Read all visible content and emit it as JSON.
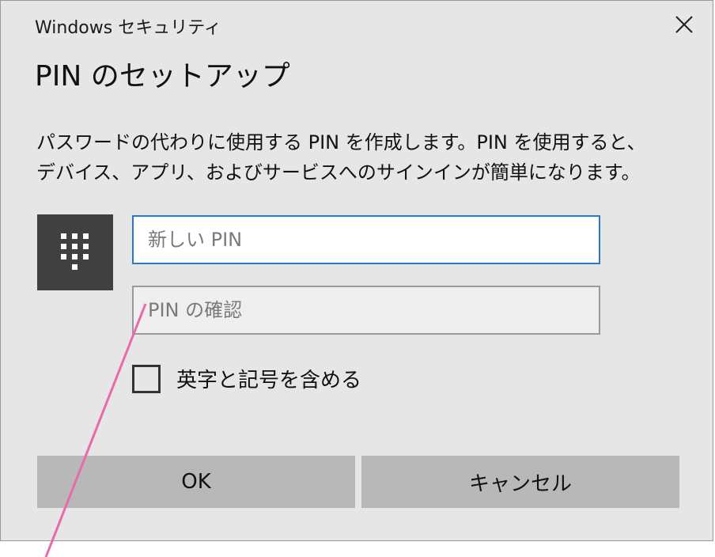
{
  "window": {
    "title": "Windows セキュリティ"
  },
  "dialog": {
    "heading": "PIN のセットアップ",
    "description_lines": [
      "パスワードの代わりに使用する PIN を作成します。PIN を使用すると、",
      "デバイス、アプリ、およびサービスへのサインインが簡単になります。"
    ]
  },
  "form": {
    "new_pin_placeholder": "新しい PIN",
    "new_pin_value": "",
    "confirm_pin_placeholder": "PIN の確認",
    "confirm_pin_value": "",
    "include_letters_label": "英字と記号を含める",
    "include_letters_checked": false
  },
  "buttons": {
    "ok_label": "OK",
    "cancel_label": "キャンセル"
  },
  "icons": {
    "close": "close-icon",
    "keypad": "keypad-icon"
  },
  "colors": {
    "dialog_background": "#e6e6e6",
    "focus_border": "#2a78c8",
    "button_background": "#b8b8b8",
    "keypad_tile": "#404040",
    "annotation_line": "#e86aa8"
  }
}
